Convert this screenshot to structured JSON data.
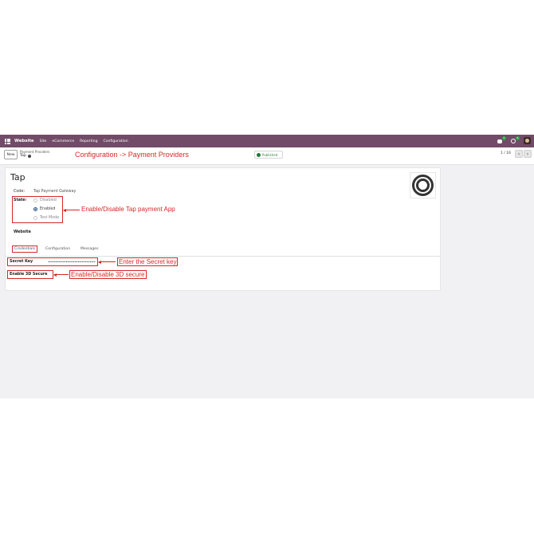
{
  "topbar": {
    "brand": "Website",
    "menu": [
      "Site",
      "eCommerce",
      "Reporting",
      "Configuration"
    ],
    "chat_badge": "5",
    "activity_badge": "6"
  },
  "control": {
    "new_label": "New",
    "breadcrumb_parent": "Payment Providers",
    "breadcrumb_current": "Tap",
    "published_label": "Published",
    "pager": "1 / 16"
  },
  "annotations": {
    "title": "Configuration -> Payment Providers",
    "state": "Enable/Disable Tap payment App",
    "secret": "Enter the Secret key",
    "secure3d": "Enable/Disable 3D secure"
  },
  "form": {
    "title": "Tap",
    "code_label": "Code",
    "code_value": "Tap Payment Gateway",
    "state_label": "State",
    "state_options": [
      "Disabled",
      "Enabled",
      "Test Mode"
    ],
    "state_selected": "Enabled",
    "website_label": "Website",
    "tabs": [
      "Credentials",
      "Configuration",
      "Messages"
    ],
    "active_tab": "Credentials",
    "secret_label": "Secret Key",
    "secret_value": "••••••••••••••••••••••••••••••••",
    "secure3d_label": "Enable 3D Secure"
  },
  "colors": {
    "navbar": "#714b67",
    "annotation": "#d62828",
    "link": "#2c5a8c",
    "published": "#2e8540"
  }
}
